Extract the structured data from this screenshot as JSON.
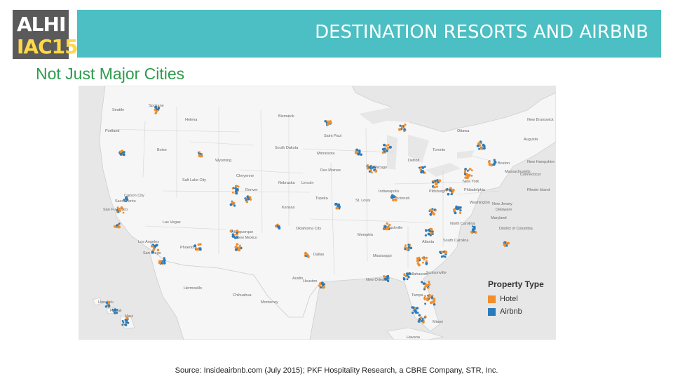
{
  "logo": {
    "line1": "ALHI",
    "line2": "IAC15"
  },
  "header": {
    "title": "DESTINATION RESORTS AND AIRBNB"
  },
  "subtitle": "Not Just Major Cities",
  "legend": {
    "title": "Property Type",
    "items": [
      {
        "label": "Hotel",
        "color": "#f28e2b"
      },
      {
        "label": "Airbnb",
        "color": "#2b7bba"
      }
    ]
  },
  "source": "Source: Insideairbnb.com (July 2015); PKF Hospitality Research, a CBRE Company, STR, Inc.",
  "map": {
    "place_labels": [
      "Seattle",
      "Spokane",
      "Portland",
      "Helena",
      "Bismarck",
      "Ottawa",
      "Saint Paul",
      "Boise",
      "Wyoming",
      "Minnesota",
      "South Dakota",
      "Toronto",
      "Boston",
      "Massachusetts",
      "Salt Lake City",
      "Cheyenne",
      "Des Moines",
      "Chicago",
      "Detroit",
      "New York",
      "Carson City",
      "Nebraska",
      "Lincoln",
      "Indianapolis",
      "Pittsburgh",
      "Philadelphia",
      "San Francisco",
      "Sacramento",
      "Denver",
      "Topeka",
      "St. Louis",
      "Cincinnati",
      "Washington",
      "Las Vegas",
      "Kansas",
      "Los Angeles",
      "Oklahoma City",
      "Memphis",
      "Nashville",
      "North Carolina",
      "Phoenix",
      "New Mexico",
      "Albuquerque",
      "Atlanta",
      "South Carolina",
      "Dallas",
      "Mississippi",
      "San Diego",
      "Tallahassee",
      "Austin",
      "Houston",
      "New Orleans",
      "Jacksonville",
      "Hermosillo",
      "Chihuahua",
      "Monterrey",
      "Tampa",
      "Miami",
      "Havana",
      "Honolulu",
      "Maui",
      "Hawaii",
      "Augusta",
      "New Jersey",
      "Maryland",
      "Rhode Island",
      "New Hampshire",
      "New Brunswick",
      "Delaware",
      "District of Columbia",
      "Connecticut"
    ]
  }
}
